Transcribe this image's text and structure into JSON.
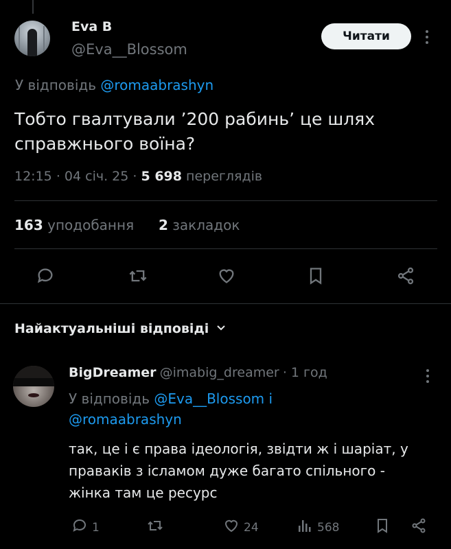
{
  "tweet": {
    "author_name": "Eva B",
    "author_handle": "@Eva__Blossom",
    "follow_label": "Читати",
    "more_icon": "more-dots-icon",
    "reply_prefix": "У відповідь",
    "reply_mention": "@romaabrashyn",
    "text_line1": "Тобто гвалтували ’200 рабинь’ це шлях",
    "text_line2": "справжнього воїна?",
    "time": "12:15",
    "date": "04 січ. 25",
    "views_count": "5 698",
    "views_label": "переглядів",
    "likes_count": "163",
    "likes_label": "уподобання",
    "bookmarks_count": "2",
    "bookmarks_label": "закладок"
  },
  "actions": [
    "reply-icon",
    "retweet-icon",
    "like-icon",
    "bookmark-icon",
    "share-icon"
  ],
  "replies_section": {
    "title": "Найактуальніші відповіді"
  },
  "reply": {
    "author_name": "BigDreamer",
    "author_handle": "@imabig_dreamer",
    "time": "1 год",
    "reply_prefix": "У відповідь",
    "mention1": "@Eva__Blossom",
    "conj": "і",
    "mention2": "@romaabrashyn",
    "text_line1": "так, це і є права ідеологія, звідти ж і шаріат, у",
    "text_line2": "праваків з ісламом дуже багато спільного -",
    "text_line3": "жінка там це ресурс",
    "reply_count": "1",
    "like_count": "24",
    "views_count": "568"
  },
  "colors": {
    "background": "#000000",
    "text": "#e7e9ea",
    "muted": "#71767b",
    "accent": "#1d9bf0",
    "divider": "#2f3336"
  }
}
